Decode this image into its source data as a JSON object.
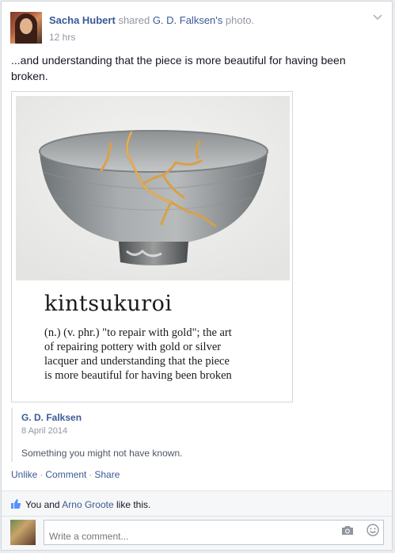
{
  "post": {
    "author": "Sacha Hubert",
    "action": "shared",
    "source_author_possessive": "G. D. Falksen's",
    "source_type": "photo.",
    "time": "12 hrs",
    "text": "...and understanding that the piece is more beautiful for having been broken."
  },
  "photo": {
    "word": "kintsukuroi",
    "definition_lines": [
      "(n.) (v. phr.) \"to repair with gold\"; the art",
      "of repairing pottery with gold or silver",
      "lacquer and understanding that the piece",
      "is more beautiful for having been broken"
    ]
  },
  "shared": {
    "author": "G. D. Falksen",
    "date": "8 April 2014",
    "text": "Something you might not have known."
  },
  "actions": {
    "unlike": "Unlike",
    "comment": "Comment",
    "share": "Share",
    "separator": "·"
  },
  "likes": {
    "prefix": "You and",
    "name": "Arno Groote",
    "suffix": "like this."
  },
  "comment_box": {
    "placeholder": "Write a comment..."
  },
  "icons": {
    "menu": "chevron-down-icon",
    "like": "thumbs-up-icon",
    "camera": "camera-icon",
    "emoji": "smiley-icon"
  },
  "colors": {
    "link": "#3b5998",
    "meta": "#9197a3",
    "kintsugi_gold": "#d9a048"
  }
}
